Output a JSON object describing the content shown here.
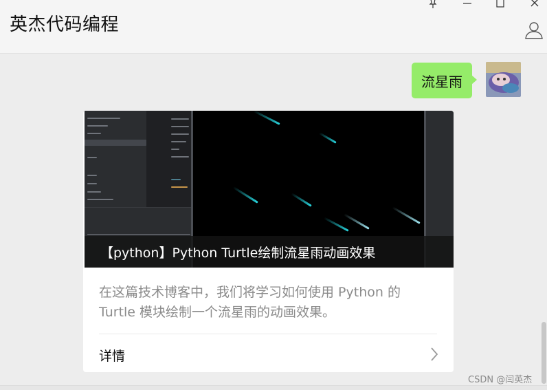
{
  "window": {
    "title": "英杰代码编程",
    "controls": [
      "pin-icon",
      "minimize-icon",
      "maximize-icon",
      "close-icon"
    ],
    "profile_icon": "person-icon"
  },
  "chat": {
    "outgoing_message": {
      "text": "流星雨",
      "bubble_color": "#95ec69"
    },
    "link_card": {
      "thumbnail_caption": "【python】Python Turtle绘制流星雨动画效果",
      "description": "在这篇技术博客中，我们将学习如何使用 Python 的 Turtle 模块绘制一个流星雨的动画效果。",
      "details_label": "详情",
      "chevron_icon": "chevron-right-icon"
    }
  },
  "watermark": "CSDN @闫英杰",
  "colors": {
    "background": "#ededed",
    "titlebar": "#f5f5f5",
    "meteor": "#27d7e0"
  }
}
